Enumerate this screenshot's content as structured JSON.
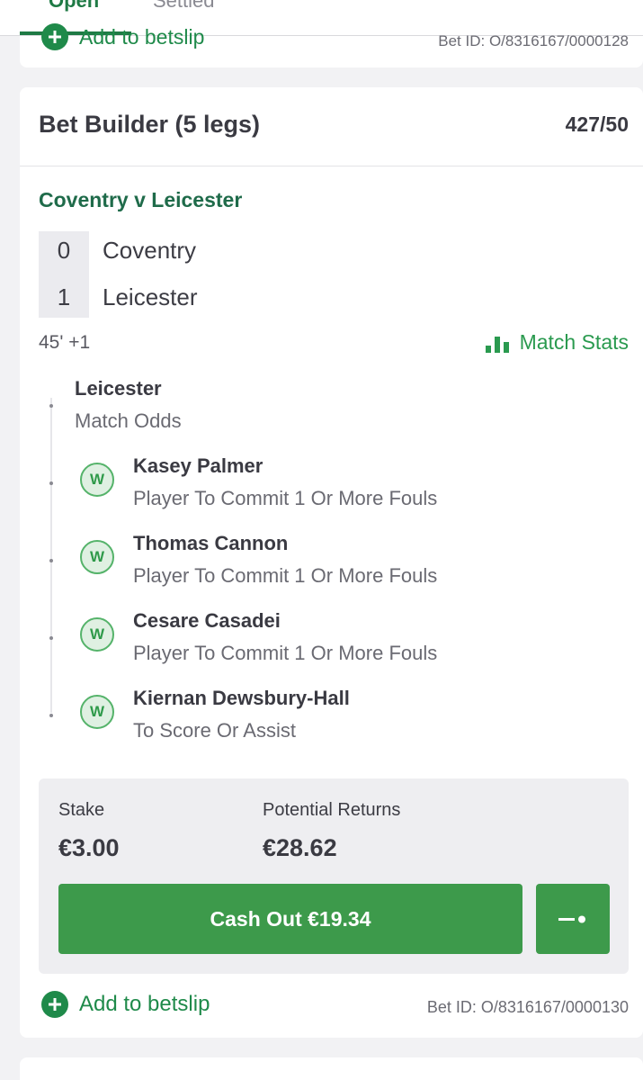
{
  "tabs": {
    "open": "Open",
    "settled": "Settled"
  },
  "previous_bet": {
    "add_label": "Add to betslip",
    "bet_id": "Bet ID: O/8316167/0000128"
  },
  "bet": {
    "title": "Bet Builder (5 legs)",
    "odds": "427/50",
    "match": "Coventry v Leicester",
    "home_score": "0",
    "home_team": "Coventry",
    "away_score": "1",
    "away_team": "Leicester",
    "time": "45' +1",
    "match_stats_label": "Match Stats",
    "result_badge": "W",
    "legs": [
      {
        "selection": "Leicester",
        "market": "Match Odds"
      },
      {
        "selection": "Kasey Palmer",
        "market": "Player To Commit 1 Or More Fouls"
      },
      {
        "selection": "Thomas Cannon",
        "market": "Player To Commit 1 Or More Fouls"
      },
      {
        "selection": "Cesare Casadei",
        "market": "Player To Commit 1 Or More Fouls"
      },
      {
        "selection": "Kiernan Dewsbury-Hall",
        "market": "To Score Or Assist"
      }
    ],
    "stake_label": "Stake",
    "stake_value": "€3.00",
    "returns_label": "Potential Returns",
    "returns_value": "€28.62",
    "cashout_label": "Cash Out €19.34",
    "add_label": "Add to betslip",
    "bet_id": "Bet ID: O/8316167/0000130"
  },
  "colors": {
    "brand_green": "#1f7a45",
    "button_green": "#3d9a4b",
    "win_badge": "#55b36a"
  }
}
